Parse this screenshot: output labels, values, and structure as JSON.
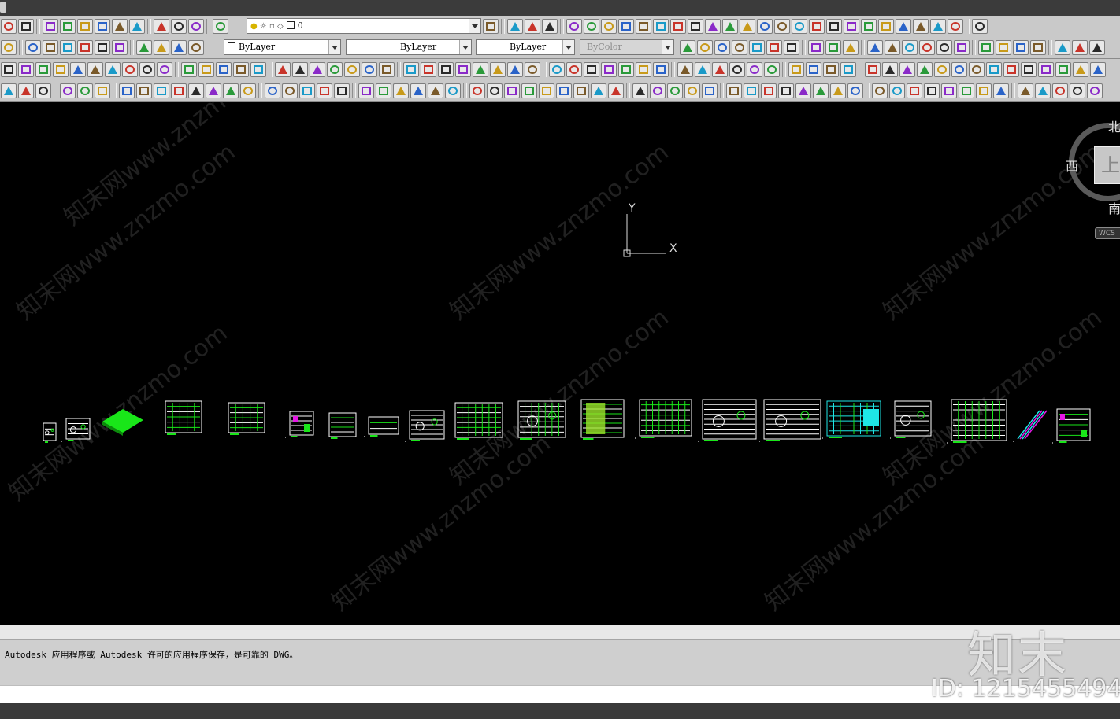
{
  "toolbar": {
    "layer_combo": {
      "value": "0"
    },
    "color_combo": {
      "value": "ByLayer"
    },
    "linetype_combo": {
      "value": "ByLayer"
    },
    "lineweight_combo": {
      "value": "ByLayer"
    },
    "plotstyle_combo": {
      "value": "ByColor"
    }
  },
  "viewcube": {
    "north": "北",
    "west": "西",
    "south": "南",
    "face": "上",
    "wcs": "WCS"
  },
  "ucs": {
    "x_label": "X",
    "y_label": "Y"
  },
  "watermark": {
    "text": "知末网www.znzmo.com"
  },
  "command_line": {
    "history": "Autodesk 应用程序或 Autodesk 许可的应用程序保存，是可靠的 DWG。"
  },
  "overlay": {
    "brand": "知末",
    "id_text": "ID: 1215455494"
  },
  "colors": {
    "canvas": "#000000",
    "toolbar": "#c9c9c9",
    "drawing_green": "#19e619",
    "drawing_cyan": "#1ee6e6",
    "drawing_white": "#ffffff",
    "drawing_magenta": "#e619e6"
  }
}
